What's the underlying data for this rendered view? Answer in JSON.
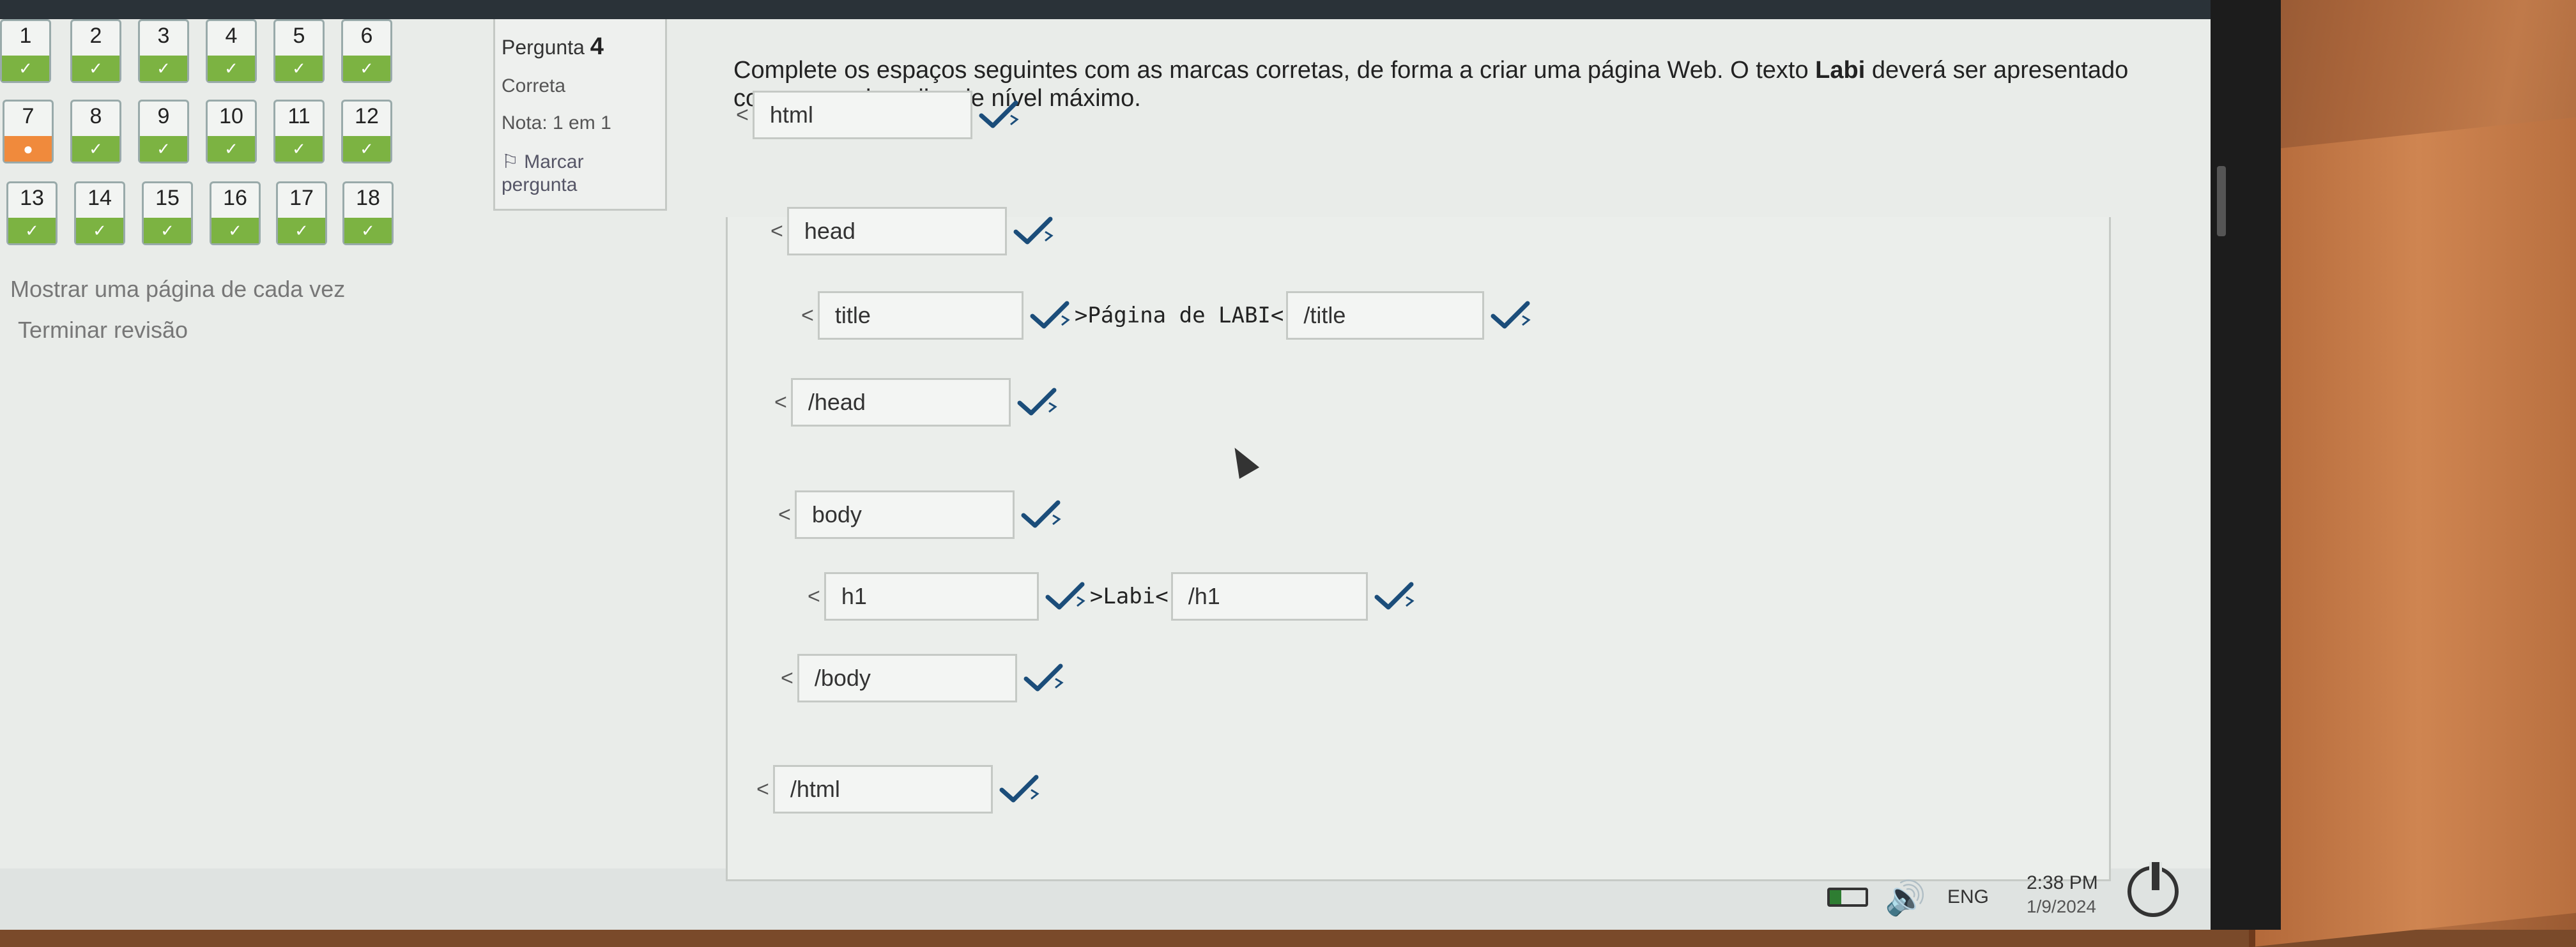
{
  "nav": {
    "buttons": [
      {
        "num": "1",
        "state": "done"
      },
      {
        "num": "2",
        "state": "done"
      },
      {
        "num": "3",
        "state": "done"
      },
      {
        "num": "4",
        "state": "done"
      },
      {
        "num": "5",
        "state": "done"
      },
      {
        "num": "6",
        "state": "done"
      },
      {
        "num": "7",
        "state": "current"
      },
      {
        "num": "8",
        "state": "done"
      },
      {
        "num": "9",
        "state": "done"
      },
      {
        "num": "10",
        "state": "done"
      },
      {
        "num": "11",
        "state": "done"
      },
      {
        "num": "12",
        "state": "done"
      },
      {
        "num": "13",
        "state": "done"
      },
      {
        "num": "14",
        "state": "done"
      },
      {
        "num": "15",
        "state": "done"
      },
      {
        "num": "16",
        "state": "done"
      },
      {
        "num": "17",
        "state": "done"
      },
      {
        "num": "18",
        "state": "done"
      }
    ],
    "check_symbol": "✓",
    "current_symbol": "●",
    "show_one_page": "Mostrar uma página de cada vez",
    "finish_review": "Terminar revisão"
  },
  "info": {
    "title_prefix": "Pergunta",
    "number": "4",
    "state": "Correta",
    "grade": "Nota: 1 em 1",
    "flag": "Marcar pergunta",
    "flag_icon": "flag-icon"
  },
  "question": {
    "text_before": "Complete os espaços seguintes com as marcas corretas, de forma a criar uma página Web. O texto ",
    "bold": "Labi",
    "text_after": " deverá ser apresentado como um cabeçalho de nível máximo."
  },
  "answers": {
    "lt": "<",
    "html_open": "html",
    "head_open": "head",
    "title_open": "title",
    "title_text": ">Página de LABI<",
    "title_close": "/title",
    "head_close": "/head",
    "body_open": "body",
    "h1_open": "h1",
    "h1_text": ">Labi<",
    "h1_close": "/h1",
    "body_close": "/body",
    "html_close": "/html"
  },
  "taskbar": {
    "lang": "ENG",
    "time": "2:38 PM",
    "date": "1/9/2024"
  },
  "colors": {
    "correct": "#7cb342",
    "current": "#f08a3c",
    "check": "#1b4d7a"
  }
}
